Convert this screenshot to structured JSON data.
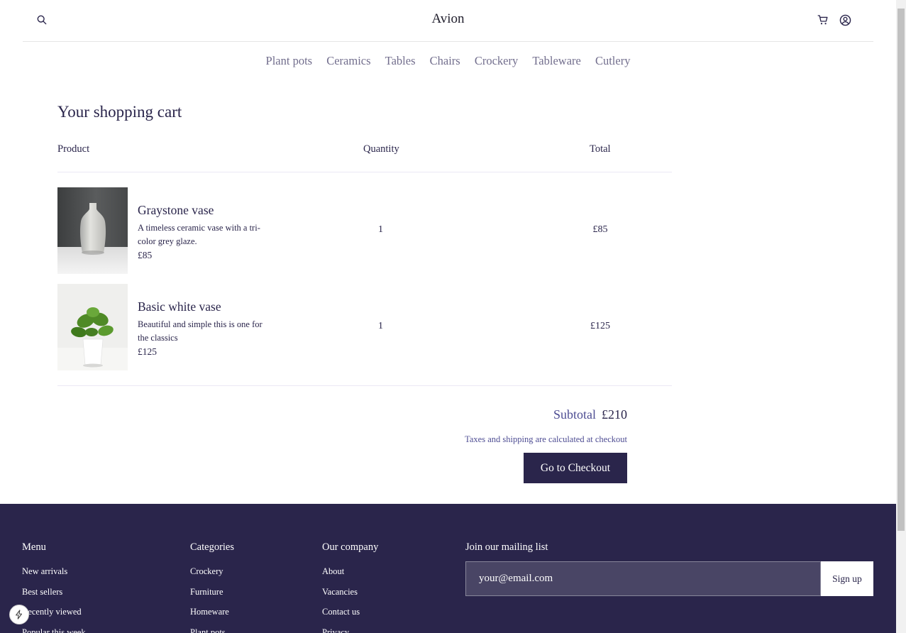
{
  "header": {
    "brand": "Avion",
    "icons": {
      "search": "search-icon",
      "cart": "cart-icon",
      "user": "user-circle-icon"
    }
  },
  "nav": {
    "categories": [
      "Plant pots",
      "Ceramics",
      "Tables",
      "Chairs",
      "Crockery",
      "Tableware",
      "Cutlery"
    ]
  },
  "cart": {
    "title": "Your shopping cart",
    "columns": {
      "product": "Product",
      "quantity": "Quantity",
      "total": "Total"
    },
    "items": [
      {
        "name": "Graystone vase",
        "description": "A timeless ceramic vase with a tri-color grey glaze.",
        "price": "£85",
        "quantity": "1",
        "total": "£85"
      },
      {
        "name": "Basic white vase",
        "description": "Beautiful and simple this is one for the classics",
        "price": "£125",
        "quantity": "1",
        "total": "£125"
      }
    ],
    "subtotal_label": "Subtotal",
    "subtotal_value": "£210",
    "taxes_note": "Taxes and shipping are calculated at checkout",
    "checkout_label": "Go to Checkout"
  },
  "footer": {
    "menu": {
      "heading": "Menu",
      "links": [
        "New arrivals",
        "Best sellers",
        "Recently viewed",
        "Popular this week"
      ]
    },
    "categories": {
      "heading": "Categories",
      "links": [
        "Crockery",
        "Furniture",
        "Homeware",
        "Plant pots"
      ]
    },
    "company": {
      "heading": "Our company",
      "links": [
        "About",
        "Vacancies",
        "Contact us",
        "Privacy"
      ]
    },
    "mailing": {
      "heading": "Join our mailing list",
      "placeholder": "your@email.com",
      "signup_label": "Sign up"
    }
  },
  "colors": {
    "primary": "#2A254B",
    "muted": "#726E8D",
    "accent": "#4E4D93"
  }
}
